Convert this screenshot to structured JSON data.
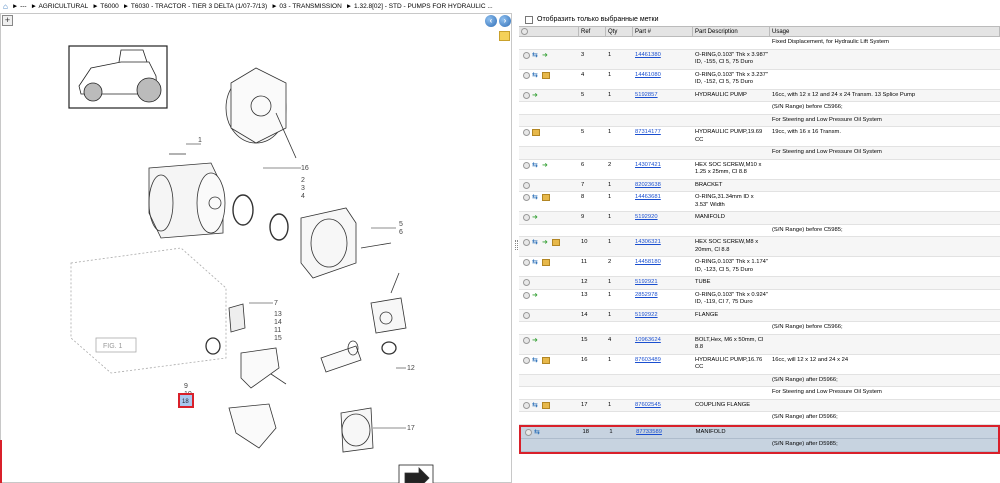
{
  "breadcrumb": {
    "items": [
      "► --- ",
      "► AGRICULTURAL",
      "► T6000",
      "► T6030 - TRACTOR - TIER 3 DELTA (1/07-7/13)",
      "► 03 - TRANSMISSION",
      "► 1.32.8[02] - STD - PUMPS FOR HYDRAULIC ..."
    ]
  },
  "filter": {
    "label": "Отобразить только выбранные метки"
  },
  "table": {
    "headers": [
      "",
      "Ref",
      "Qty",
      "Part #",
      "Part Description",
      "Usage"
    ],
    "rows": [
      {
        "type": "note",
        "usage": "Fixed Displacement, for Hydraulic Lift System"
      },
      {
        "type": "part",
        "icons": [
          "circle",
          "swap",
          "arrow"
        ],
        "ref": "3",
        "qty": "1",
        "part": "14461380",
        "desc": "O-RING,0.103\" Thk x 3.987\" ID, -155, Cl 5, 75 Duro",
        "usage": ""
      },
      {
        "type": "part",
        "icons": [
          "circle",
          "swap",
          "box"
        ],
        "ref": "4",
        "qty": "1",
        "part": "14461080",
        "desc": "O-RING,0.103\" Thk x 3.237\" ID, -152, Cl 5, 75 Duro",
        "usage": ""
      },
      {
        "type": "part",
        "icons": [
          "circle",
          "arrow"
        ],
        "ref": "5",
        "qty": "1",
        "part": "5192857",
        "desc": "HYDRAULIC PUMP",
        "usage": "16cc, with 12 x 12 and 24 x 24 Transm. 13 Splice Pump"
      },
      {
        "type": "note",
        "usage": "(S/N Range) before C5966;"
      },
      {
        "type": "note",
        "usage": "For Steering and Low Pressure Oil System"
      },
      {
        "type": "part",
        "icons": [
          "circle",
          "box"
        ],
        "ref": "5",
        "qty": "1",
        "part": "87314177",
        "desc": "HYDRAULIC PUMP,19.69 CC",
        "usage": "19cc, with 16 x 16 Transm."
      },
      {
        "type": "note",
        "usage": "For Steering and Low Pressure Oil System"
      },
      {
        "type": "part",
        "icons": [
          "circle",
          "swap",
          "arrow"
        ],
        "ref": "6",
        "qty": "2",
        "part": "14307421",
        "desc": "HEX SOC SCREW,M10 x 1.25 x 25mm, Cl 8.8",
        "usage": ""
      },
      {
        "type": "part",
        "icons": [
          "circle"
        ],
        "ref": "7",
        "qty": "1",
        "part": "82023638",
        "desc": "BRACKET",
        "usage": ""
      },
      {
        "type": "part",
        "icons": [
          "circle",
          "swap",
          "box"
        ],
        "ref": "8",
        "qty": "1",
        "part": "14463681",
        "desc": "O-RING,31.34mm ID x 3.53\" Width",
        "usage": ""
      },
      {
        "type": "part",
        "icons": [
          "circle",
          "arrow"
        ],
        "ref": "9",
        "qty": "1",
        "part": "5192920",
        "desc": "MANIFOLD",
        "usage": ""
      },
      {
        "type": "note",
        "usage": "(S/N Range) before C5985;"
      },
      {
        "type": "part",
        "icons": [
          "circle",
          "swap",
          "arrow",
          "box"
        ],
        "ref": "10",
        "qty": "1",
        "part": "14306321",
        "desc": "HEX SOC SCREW,M8 x 20mm, Cl 8.8",
        "usage": ""
      },
      {
        "type": "part",
        "icons": [
          "circle",
          "swap",
          "box"
        ],
        "ref": "11",
        "qty": "2",
        "part": "14458180",
        "desc": "O-RING,0.103\" Thk x 1.174\" ID, -123, Cl 5, 75 Duro",
        "usage": ""
      },
      {
        "type": "part",
        "icons": [
          "circle"
        ],
        "ref": "12",
        "qty": "1",
        "part": "5192921",
        "desc": "TUBE",
        "usage": ""
      },
      {
        "type": "part",
        "icons": [
          "circle",
          "arrow"
        ],
        "ref": "13",
        "qty": "1",
        "part": "2852978",
        "desc": "O-RING,0.103\" Thk x 0.924\" ID, -119, Cl 7, 75 Duro",
        "usage": ""
      },
      {
        "type": "part",
        "icons": [
          "circle"
        ],
        "ref": "14",
        "qty": "1",
        "part": "5192922",
        "desc": "FLANGE",
        "usage": ""
      },
      {
        "type": "note",
        "usage": "(S/N Range) before C5966;"
      },
      {
        "type": "part",
        "icons": [
          "circle",
          "arrow"
        ],
        "ref": "15",
        "qty": "4",
        "part": "10963624",
        "desc": "BOLT,Hex, M6 x 50mm, Cl 8.8",
        "usage": ""
      },
      {
        "type": "part",
        "icons": [
          "circle",
          "swap",
          "box"
        ],
        "ref": "16",
        "qty": "1",
        "part": "87603489",
        "desc": "HYDRAULIC PUMP,16.76 CC",
        "usage": "16cc, will 12 x 12 and 24 x 24"
      },
      {
        "type": "note",
        "usage": "(S/N Range) after D5966;"
      },
      {
        "type": "note",
        "usage": "For Steering and Low Pressure Oil System"
      },
      {
        "type": "part",
        "icons": [
          "circle",
          "swap",
          "box"
        ],
        "ref": "17",
        "qty": "1",
        "part": "87602545",
        "desc": "COUPLING FLANGE",
        "usage": ""
      },
      {
        "type": "note",
        "usage": "(S/N Range) after D5966;"
      }
    ],
    "selected": {
      "ref": "18",
      "qty": "1",
      "part": "87733589",
      "desc": "MANIFOLD",
      "usage": "(S/N Range) after D5985;"
    }
  },
  "drawing": {
    "fig_label": "FIG. 1",
    "callouts": [
      "1",
      "18",
      "2",
      "3",
      "4",
      "5",
      "6",
      "7",
      "8",
      "9",
      "10",
      "11",
      "12",
      "13",
      "14",
      "15",
      "16",
      "17"
    ],
    "selected_callout": "18"
  }
}
